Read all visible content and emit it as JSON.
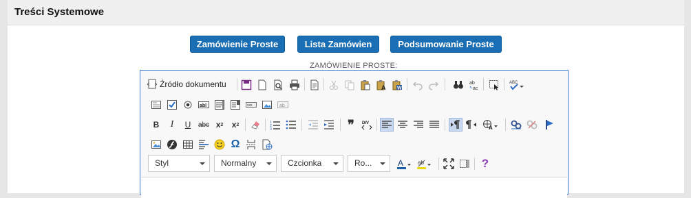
{
  "panel": {
    "title": "Treści Systemowe"
  },
  "buttons": [
    {
      "label": "Zamówienie Proste"
    },
    {
      "label": "Lista Zamówien"
    },
    {
      "label": "Podsumowanie Proste"
    }
  ],
  "editor": {
    "label": "ZAMÓWIENIE PROSTE:",
    "source_label": "Źródło dokumentu",
    "combos": {
      "style": "Styl",
      "format": "Normalny",
      "font": "Czcionka",
      "size": "Ro..."
    },
    "glyphs": {
      "bold": "B",
      "italic": "I",
      "underline": "U",
      "strike": "abc",
      "subscript": "x",
      "superscript": "x",
      "sub_mark": "2",
      "sup_mark": "2",
      "quote": "❞",
      "omega": "Ω",
      "help": "?",
      "textcolor": "A",
      "bgcolor": "ab",
      "lang": "A",
      "spell": "ABC",
      "replace_ab": "ab",
      "replace_ac": "ac",
      "field_abl": "abl",
      "field_xxx": "xxx",
      "field_ab": "ab",
      "div": "DIV"
    },
    "colors": {
      "accent": "#1a6fb4",
      "border": "#3b78c8"
    }
  }
}
